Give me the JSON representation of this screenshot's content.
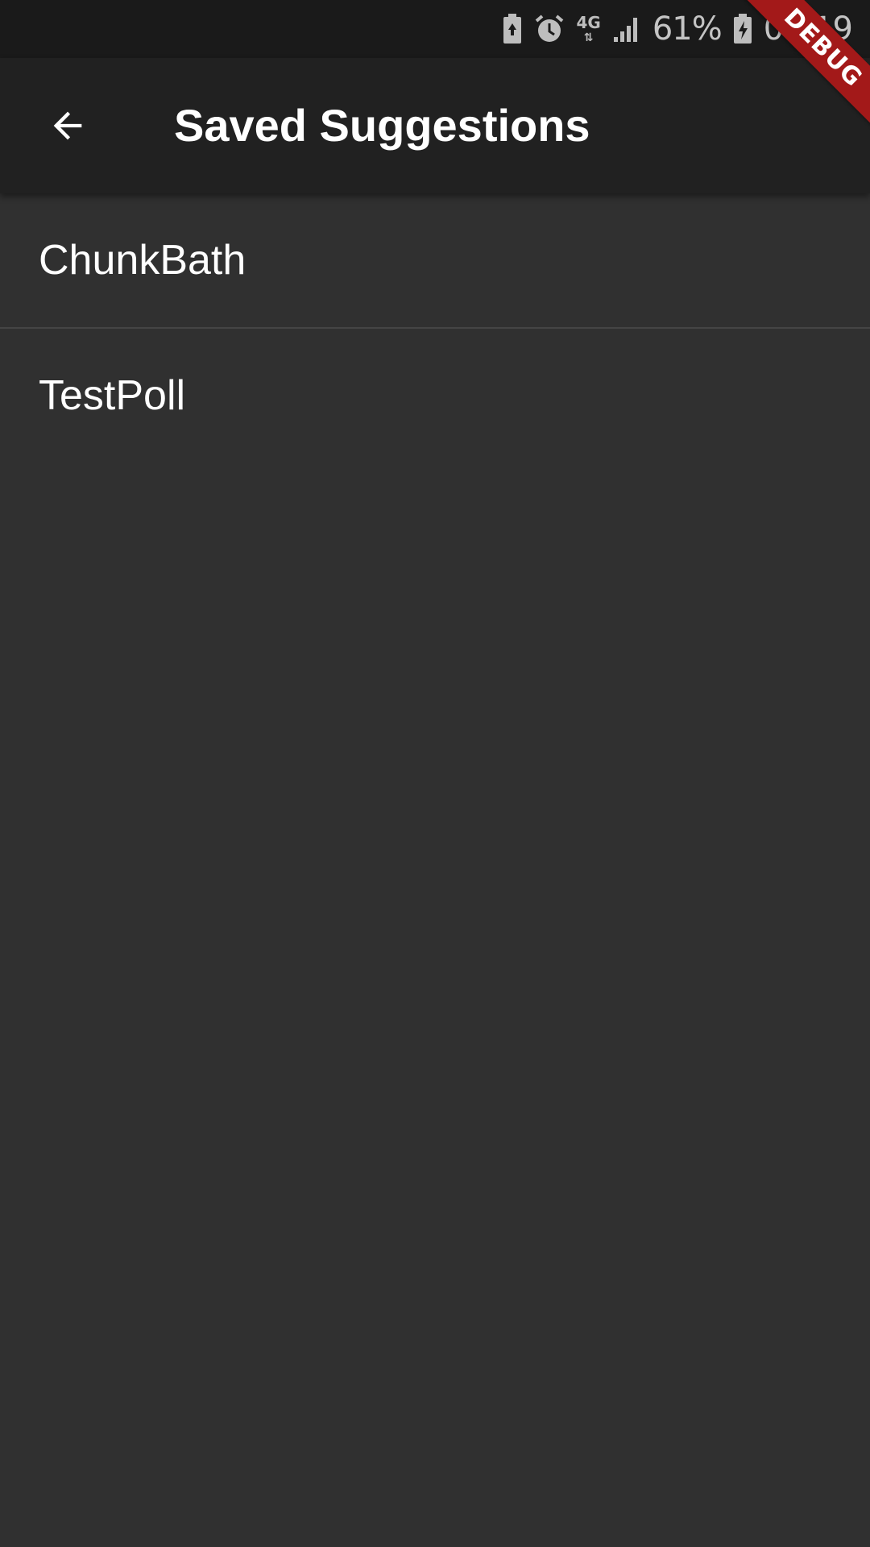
{
  "status_bar": {
    "network": "4G",
    "battery_percent": "61%",
    "time": "09:19",
    "icons": [
      "battery-saver-icon",
      "alarm-icon",
      "network-4g-icon",
      "signal-icon",
      "battery-charging-icon"
    ]
  },
  "app_bar": {
    "title": "Saved Suggestions",
    "back_icon": "arrow-back-icon"
  },
  "list": {
    "items": [
      {
        "label": "ChunkBath"
      },
      {
        "label": "TestPoll"
      }
    ]
  },
  "debug_banner": {
    "label": "DEBUG",
    "color": "#a31919"
  },
  "colors": {
    "background": "#303030",
    "app_bar": "#212121",
    "status_bar": "#1a1a1a",
    "text": "#ffffff"
  }
}
